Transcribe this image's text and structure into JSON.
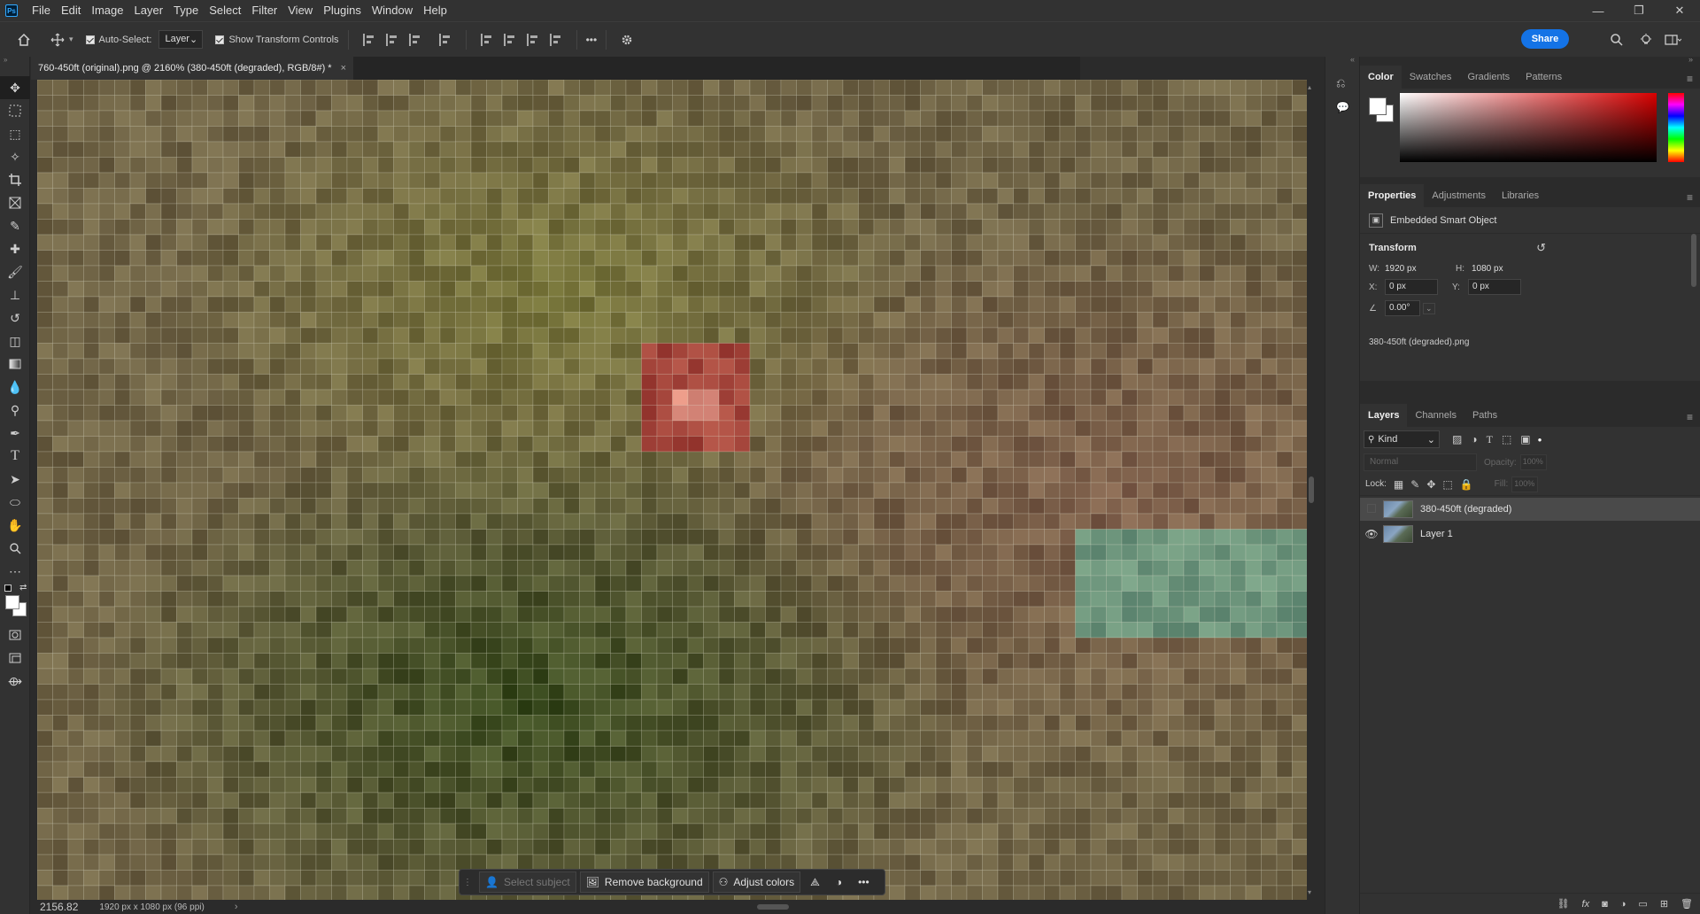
{
  "menubar": {
    "logo": "Ps",
    "items": [
      "File",
      "Edit",
      "Image",
      "Layer",
      "Type",
      "Select",
      "Filter",
      "View",
      "Plugins",
      "Window",
      "Help"
    ]
  },
  "options": {
    "auto_select_label": "Auto-Select:",
    "auto_select_target": "Layer",
    "show_transform_label": "Show Transform Controls",
    "more_label": "•••",
    "share_label": "Share"
  },
  "document": {
    "tab_title": "760-450ft (original).png @ 2160% (380-450ft (degraded), RGB/8#) *",
    "close": "×"
  },
  "status": {
    "zoom": "2156.82",
    "doc_info": "1920 px x 1080 px (96 ppi)",
    "arrow": "›"
  },
  "context_bar": {
    "select_subject": "Select subject",
    "remove_background": "Remove background",
    "adjust_colors": "Adjust colors",
    "more": "•••"
  },
  "color_panel": {
    "tabs": [
      "Color",
      "Swatches",
      "Gradients",
      "Patterns"
    ],
    "menu": "≡"
  },
  "properties_panel": {
    "tabs": [
      "Properties",
      "Adjustments",
      "Libraries"
    ],
    "menu": "≡",
    "object_type": "Embedded Smart Object",
    "transform_heading": "Transform",
    "w_label": "W:",
    "w_value": "1920 px",
    "h_label": "H:",
    "h_value": "1080 px",
    "x_label": "X:",
    "x_value": "0 px",
    "y_label": "Y:",
    "y_value": "0 px",
    "angle_value": "0.00°",
    "linked_file": "380-450ft (degraded).png"
  },
  "layers_panel": {
    "tabs": [
      "Layers",
      "Channels",
      "Paths"
    ],
    "menu": "≡",
    "filter_kind": "Kind",
    "blend_mode": "Normal",
    "opacity_label": "Opacity:",
    "opacity_value": "100%",
    "lock_label": "Lock:",
    "fill_label": "Fill:",
    "fill_value": "100%",
    "layers": [
      {
        "name": "380-450ft (degraded)",
        "visible": false,
        "selected": true
      },
      {
        "name": "Layer 1",
        "visible": true,
        "selected": false
      }
    ]
  },
  "window_controls": [
    "—",
    "❐",
    "✕"
  ],
  "colors": {
    "accent": "#1473e6",
    "ui_bg": "#323232",
    "dark_bg": "#2b2b2b"
  }
}
